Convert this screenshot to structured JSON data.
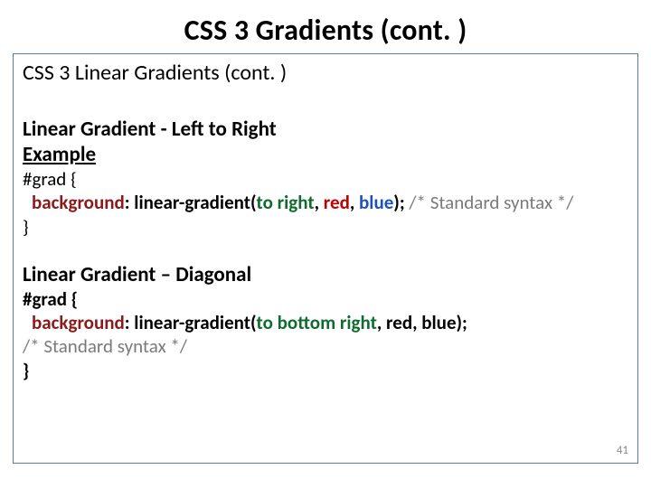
{
  "title": "CSS 3 Gradients (cont. )",
  "subtitle": "CSS 3 Linear Gradients (cont. )",
  "section1": {
    "heading": "Linear Gradient - Left to Right",
    "example_label": "Example",
    "code_open": "#grad {",
    "prop": "background",
    "colon_func": ": linear-gradient(",
    "dir": "to right",
    "sep1": ", ",
    "arg1": "red",
    "sep2": ", ",
    "arg2": "blue",
    "close_paren": "); ",
    "comment": "/* Standard syntax */",
    "code_close": "}"
  },
  "section2": {
    "heading": "Linear Gradient – Diagonal",
    "code_open": "#grad {",
    "prop": "background",
    "colon_func": ": linear-gradient(",
    "dir": "to bottom right",
    "rest": ", red, blue);",
    "comment": "/* Standard syntax */",
    "code_close": "}"
  },
  "page_number": "41"
}
